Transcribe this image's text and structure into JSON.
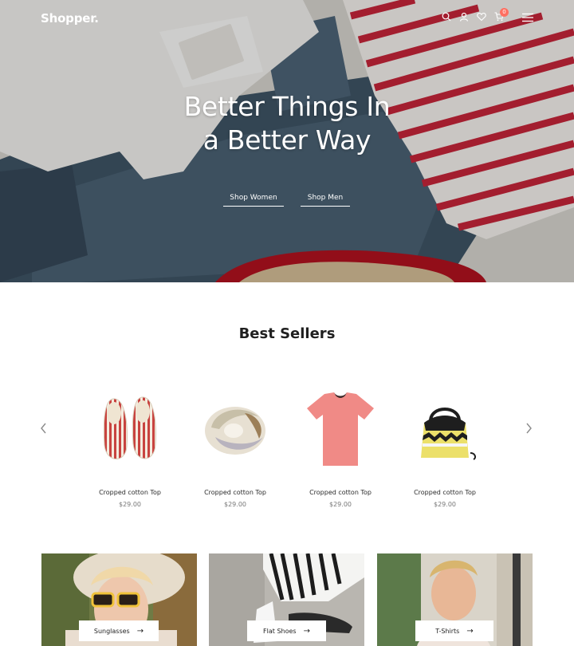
{
  "header": {
    "logo": "Shopper.",
    "cart_count": "0"
  },
  "hero": {
    "title_line1": "Better Things In",
    "title_line2": "a Better Way",
    "link_women": "Shop Women",
    "link_men": "Shop Men"
  },
  "best_sellers": {
    "title": "Best Sellers",
    "products": [
      {
        "name": "Cropped cotton Top",
        "price": "$29.00"
      },
      {
        "name": "Cropped cotton Top",
        "price": "$29.00"
      },
      {
        "name": "Cropped cotton Top",
        "price": "$29.00"
      },
      {
        "name": "Cropped cotton Top",
        "price": "$29.00"
      }
    ]
  },
  "categories": [
    {
      "label": "Sunglasses"
    },
    {
      "label": "Flat Shoes"
    },
    {
      "label": "T-Shirts"
    }
  ],
  "colors": {
    "accent": "#ff6f61",
    "text": "#1f1f1f"
  }
}
